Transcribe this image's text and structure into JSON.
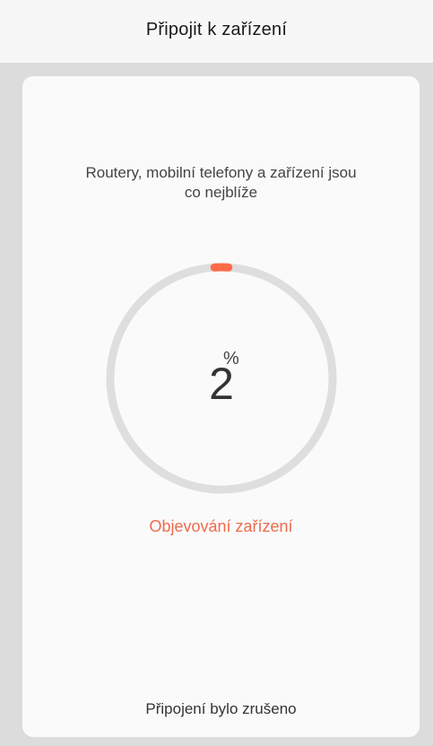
{
  "header": {
    "title": "Připojit k zařízení"
  },
  "card": {
    "hint_line1": "Routery, mobilní telefony a zařízení jsou",
    "hint_line2": "co nejblíže",
    "progress": {
      "value": 2,
      "percent_sign": "%",
      "track_color": "#dedede",
      "fill_color": "#ff6a48"
    },
    "status_text": "Objevování zařízení",
    "status_color": "#f06a4b",
    "footer_text": "Připojení bylo zrušeno"
  }
}
